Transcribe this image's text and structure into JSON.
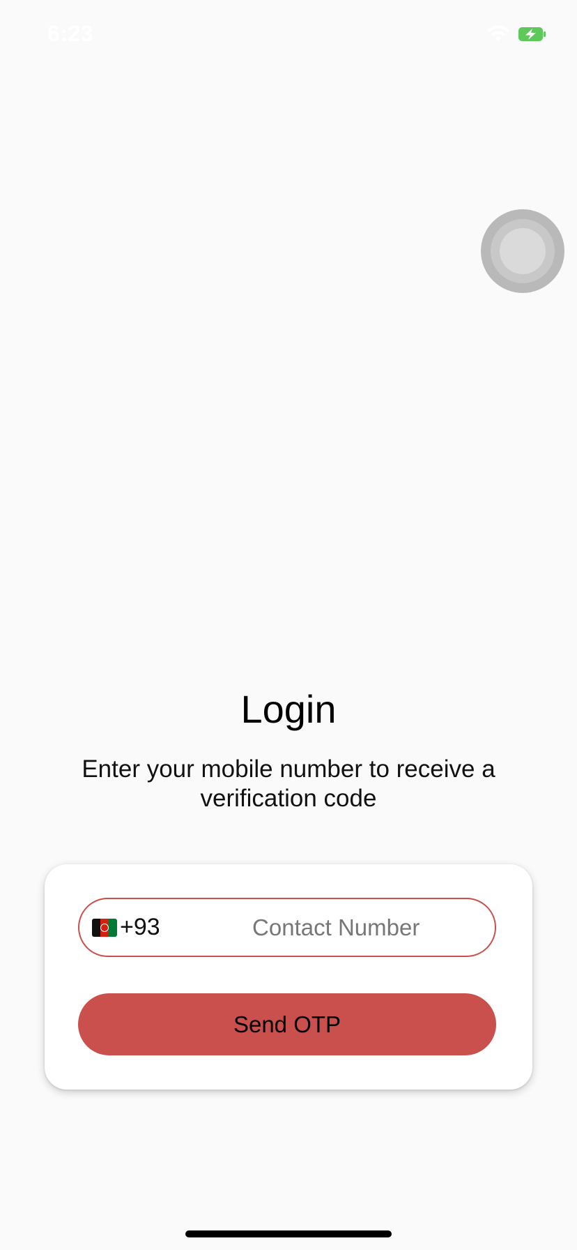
{
  "status_bar": {
    "time": "6:23",
    "wifi_icon": "wifi-icon",
    "battery_icon": "battery-charging-icon",
    "battery_color": "#5ec95a"
  },
  "assistive_touch": {
    "icon": "assistive-touch-icon"
  },
  "login": {
    "title": "Login",
    "subtitle": "Enter your mobile number to receive a verification code",
    "phone": {
      "flag_icon": "afghanistan-flag-icon",
      "dial_code": "+93",
      "value": "",
      "placeholder": "Contact Number"
    },
    "send_button_label": "Send OTP",
    "accent_color": "#c9504c"
  }
}
